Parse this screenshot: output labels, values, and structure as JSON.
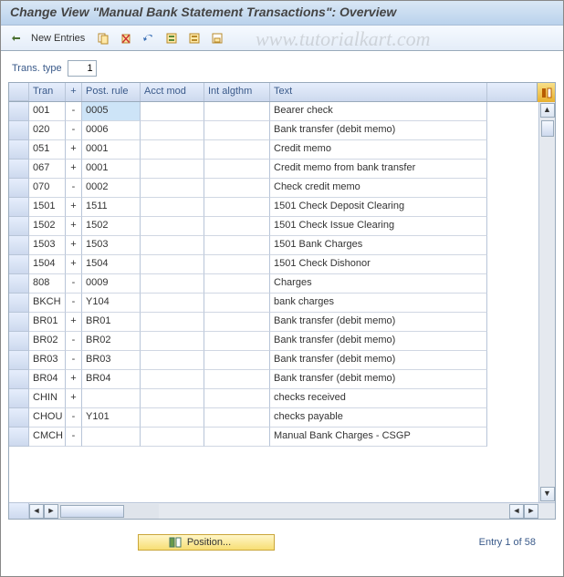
{
  "title": "Change View \"Manual Bank Statement Transactions\": Overview",
  "watermark": "www.tutorialkart.com",
  "toolbar": {
    "new_entries": "New Entries"
  },
  "field": {
    "label": "Trans. type",
    "value": "1"
  },
  "columns": {
    "tran": "Tran",
    "pm": "+",
    "post": "Post. rule",
    "acct": "Acct mod",
    "int": "Int algthm",
    "text": "Text"
  },
  "rows": [
    {
      "tran": "001",
      "pm": "-",
      "post": "0005",
      "acct": "",
      "int": "",
      "text": "Bearer check",
      "sel": true
    },
    {
      "tran": "020",
      "pm": "-",
      "post": "0006",
      "acct": "",
      "int": "",
      "text": "Bank transfer (debit memo)"
    },
    {
      "tran": "051",
      "pm": "+",
      "post": "0001",
      "acct": "",
      "int": "",
      "text": "Credit memo"
    },
    {
      "tran": "067",
      "pm": "+",
      "post": "0001",
      "acct": "",
      "int": "",
      "text": "Credit memo from bank transfer"
    },
    {
      "tran": "070",
      "pm": "-",
      "post": "0002",
      "acct": "",
      "int": "",
      "text": "Check credit memo"
    },
    {
      "tran": "1501",
      "pm": "+",
      "post": "1511",
      "acct": "",
      "int": "",
      "text": "1501 Check Deposit Clearing"
    },
    {
      "tran": "1502",
      "pm": "+",
      "post": "1502",
      "acct": "",
      "int": "",
      "text": "1501 Check Issue Clearing"
    },
    {
      "tran": "1503",
      "pm": "+",
      "post": "1503",
      "acct": "",
      "int": "",
      "text": "1501 Bank Charges"
    },
    {
      "tran": "1504",
      "pm": "+",
      "post": "1504",
      "acct": "",
      "int": "",
      "text": "1501 Check Dishonor"
    },
    {
      "tran": "808",
      "pm": "-",
      "post": "0009",
      "acct": "",
      "int": "",
      "text": "Charges"
    },
    {
      "tran": "BKCH",
      "pm": "-",
      "post": "Y104",
      "acct": "",
      "int": "",
      "text": "bank charges"
    },
    {
      "tran": "BR01",
      "pm": "+",
      "post": "BR01",
      "acct": "",
      "int": "",
      "text": "Bank transfer (debit memo)"
    },
    {
      "tran": "BR02",
      "pm": "-",
      "post": "BR02",
      "acct": "",
      "int": "",
      "text": "Bank transfer (debit memo)"
    },
    {
      "tran": "BR03",
      "pm": "-",
      "post": "BR03",
      "acct": "",
      "int": "",
      "text": "Bank transfer (debit memo)"
    },
    {
      "tran": "BR04",
      "pm": "+",
      "post": "BR04",
      "acct": "",
      "int": "",
      "text": "Bank transfer (debit memo)"
    },
    {
      "tran": "CHIN",
      "pm": "+",
      "post": "",
      "acct": "",
      "int": "",
      "text": "checks received"
    },
    {
      "tran": "CHOU",
      "pm": "-",
      "post": "Y101",
      "acct": "",
      "int": "",
      "text": "checks payable"
    },
    {
      "tran": "CMCH",
      "pm": "-",
      "post": "",
      "acct": "",
      "int": "",
      "text": "Manual Bank Charges - CSGP"
    }
  ],
  "footer": {
    "position": "Position...",
    "entry": "Entry 1 of 58"
  }
}
